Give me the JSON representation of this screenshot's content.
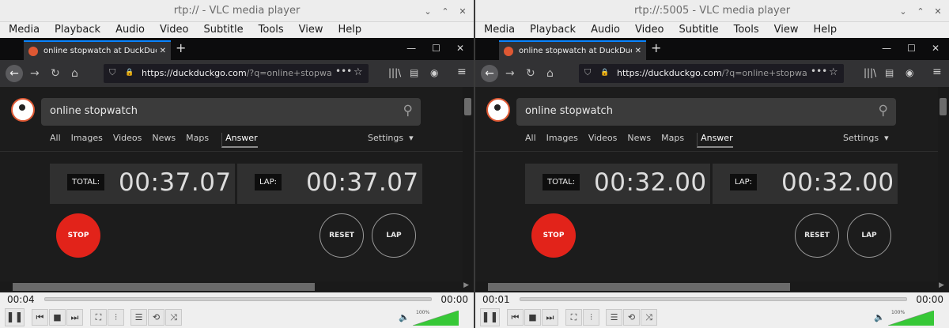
{
  "colors": {
    "stop": "#e2231a",
    "firefox_accent": "#0a84ff",
    "ddg_orange": "#de5833",
    "volume_green": "#37c837"
  },
  "icons": {
    "minimize": "⌄",
    "maximize": "⌃",
    "close": "✕",
    "back": "←",
    "forward": "→",
    "reload": "↻",
    "home": "⌂",
    "shield": "⛉",
    "lock": "🔒",
    "dots": "•••",
    "star": "☆",
    "library": "|||\\",
    "sidebar": "▤",
    "account": "◉",
    "menu": "≡",
    "search": "⚲",
    "new_tab": "+",
    "tab_close": "✕",
    "ff_minimize": "—",
    "ff_maximize": "☐",
    "ff_close": "✕",
    "play_pause": "❚❚",
    "prev": "⏮",
    "stop": "■",
    "next": "⏭",
    "fullscreen": "⛶",
    "equalizer": "⫶",
    "playlist": "☰",
    "loop": "⟲",
    "shuffle": "⤨",
    "speaker": "🔈",
    "dropdown": "▾",
    "scroll_right": "▶"
  },
  "menu": [
    "Media",
    "Playback",
    "Audio",
    "Video",
    "Subtitle",
    "Tools",
    "View",
    "Help"
  ],
  "windows": [
    {
      "title": "rtp:// - VLC media player",
      "browser": {
        "tab_title": "online stopwatch at DuckDuckGo",
        "url_host": "https://duckduckgo.com",
        "url_rest": "/?q=online+stopwatch&",
        "search_query": "online stopwatch",
        "search_tabs": [
          "All",
          "Images",
          "Videos",
          "News",
          "Maps",
          "Answer"
        ],
        "settings": "Settings",
        "total_label": "TOTAL:",
        "total_value": "00:37.07",
        "lap_label": "LAP:",
        "lap_value": "00:37.07",
        "stop_label": "STOP",
        "reset_label": "RESET",
        "lap_button_label": "LAP"
      },
      "elapsed": "00:04",
      "duration": "00:00",
      "volume_label": "100%",
      "volume_level": 1.0
    },
    {
      "title": "rtp://:5005 - VLC media player",
      "browser": {
        "tab_title": "online stopwatch at DuckDuckGo",
        "url_host": "https://duckduckgo.com",
        "url_rest": "/?q=online+stopwatch&",
        "search_query": "online stopwatch",
        "search_tabs": [
          "All",
          "Images",
          "Videos",
          "News",
          "Maps",
          "Answer"
        ],
        "settings": "Settings",
        "total_label": "TOTAL:",
        "total_value": "00:32.00",
        "lap_label": "LAP:",
        "lap_value": "00:32.00",
        "stop_label": "STOP",
        "reset_label": "RESET",
        "lap_button_label": "LAP"
      },
      "elapsed": "00:01",
      "duration": "00:00",
      "volume_label": "100%",
      "volume_level": 1.0
    }
  ]
}
